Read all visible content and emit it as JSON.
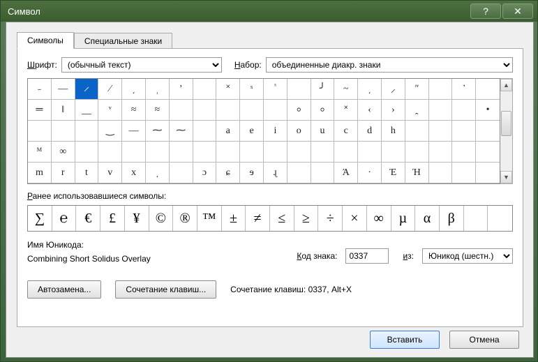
{
  "title": "Символ",
  "tabs": {
    "symbols": "Символы",
    "special": "Специальные знаки"
  },
  "font": {
    "label_pre": "Ш",
    "label_rest": "рифт:",
    "value": "(обычный текст)"
  },
  "set": {
    "label_pre": "Н",
    "label_rest": "абор:",
    "value": "объединенные диакр. знаки"
  },
  "grid": {
    "rows": [
      [
        "˗",
        "—",
        "̷",
        "∕",
        "͵",
        "⸒",
        "ʼ",
        "",
        "˟",
        "ˢ",
        "ᷤ",
        "",
        "╯",
        "~",
        "͵",
        "⸝",
        "ʺ",
        "",
        "˺",
        ""
      ],
      [
        "═",
        "‖",
        "⸏",
        "ͮ",
        "≈",
        "≈",
        "",
        "",
        "",
        "",
        "",
        "⸰",
        "⸰",
        "˟",
        "‹",
        "›",
        "ꞈ",
        "",
        "",
        "•"
      ],
      [
        "",
        "",
        "",
        "‿",
        "—",
        "⁓",
        "⁓",
        "",
        "a",
        "e",
        "i",
        "o",
        "u",
        "c",
        "d",
        "h"
      ],
      [
        "ᴹ",
        "∞",
        "",
        "",
        "",
        "",
        "",
        "",
        "",
        "",
        "",
        "",
        "",
        "",
        "",
        "",
        "",
        "",
        "",
        ""
      ],
      [
        "m",
        "r",
        "t",
        "v",
        "x",
        "͵",
        "",
        "ɔ",
        "ɕ",
        "ɘ",
        "ɻ",
        "",
        "",
        "Ά",
        "·",
        "Έ",
        "Ή"
      ]
    ],
    "selected": [
      0,
      2
    ]
  },
  "recent": {
    "label_pre": "Р",
    "label_rest": "анее использовавшиеся символы:",
    "items": [
      "∑",
      "℮",
      "€",
      "£",
      "¥",
      "©",
      "®",
      "™",
      "±",
      "≠",
      "≤",
      "≥",
      "÷",
      "×",
      "∞",
      "µ",
      "α",
      "β"
    ]
  },
  "unicode": {
    "label": "Имя Юникода:",
    "name": "Combining Short Solidus Overlay",
    "code_label_pre": "К",
    "code_label_rest": "од знака:",
    "code": "0337",
    "from_label_pre": "и",
    "from_label_rest": "з:",
    "from": "Юникод (шестн.)"
  },
  "buttons": {
    "autocorrect": "Автозамена...",
    "shortcut": "Сочетание клавиш...",
    "shortcut_text": "Сочетание клавиш: 0337, Alt+X",
    "insert": "Вставить",
    "cancel": "Отмена"
  }
}
